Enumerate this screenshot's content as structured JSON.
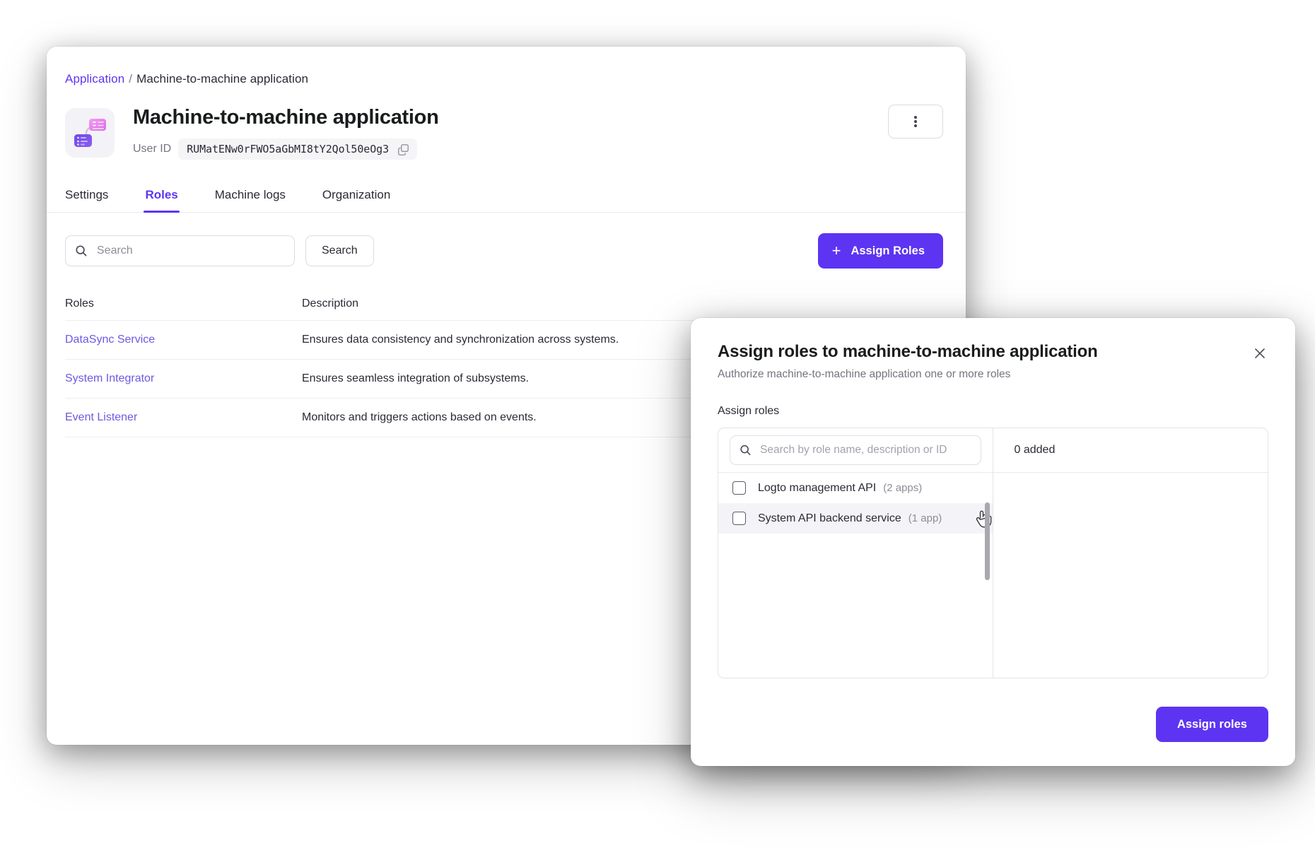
{
  "breadcrumb": {
    "root": "Application",
    "separator": "/",
    "current": "Machine-to-machine application"
  },
  "app_header": {
    "icon_name": "machine-to-machine-app-icon",
    "title": "Machine-to-machine application",
    "user_id_label": "User ID",
    "user_id_value": "RUMatENw0rFWO5aGbMI8tY2Qol50eOg3",
    "copy_icon": "copy-icon",
    "more_menu_icon": "kebab-menu-icon"
  },
  "tabs": [
    {
      "label": "Settings",
      "active": false
    },
    {
      "label": "Roles",
      "active": true
    },
    {
      "label": "Machine logs",
      "active": false
    },
    {
      "label": "Organization",
      "active": false
    }
  ],
  "toolbar": {
    "search_placeholder": "Search",
    "search_value": "",
    "search_icon": "search-icon",
    "search_button_label": "Search",
    "assign_roles_label": "Assign Roles",
    "plus_icon": "plus-icon"
  },
  "roles_table": {
    "columns": [
      "Roles",
      "Description"
    ],
    "rows": [
      {
        "role": "DataSync Service",
        "description": "Ensures data consistency and synchronization across systems."
      },
      {
        "role": "System Integrator",
        "description": "Ensures seamless integration of subsystems."
      },
      {
        "role": "Event Listener",
        "description": "Monitors and triggers actions based on events."
      }
    ]
  },
  "modal": {
    "title": "Assign roles to machine-to-machine application",
    "subtitle": "Authorize machine-to-machine application one or more roles",
    "close_icon": "close-icon",
    "field_label": "Assign roles",
    "search_placeholder": "Search by role name, description or ID",
    "search_value": "",
    "search_icon": "search-icon",
    "added_count_label": "0 added",
    "options": [
      {
        "name": "Logto management API",
        "count": "(2 apps)",
        "checked": false,
        "hovered": false
      },
      {
        "name": "System API backend service",
        "count": "(1 app)",
        "checked": false,
        "hovered": true
      }
    ],
    "submit_label": "Assign roles"
  },
  "colors": {
    "accent": "#5D34F2",
    "link": "#6B5AE0",
    "text": "#2B2A35",
    "muted": "#8E8D99",
    "border": "#DCDCE2"
  }
}
